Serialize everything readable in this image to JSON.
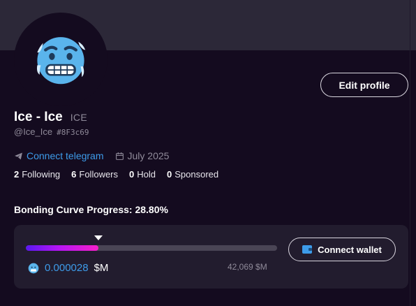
{
  "profile": {
    "name": "Ice - Ice",
    "ticker": "ICE",
    "handle": "@Ice_Ice",
    "hash": "#8F3c69",
    "avatar_icon": "cold-face-emoji",
    "edit_label": "Edit profile",
    "telegram_label": "Connect telegram",
    "date": "July 2025"
  },
  "stats": [
    {
      "count": "2",
      "label": "Following"
    },
    {
      "count": "6",
      "label": "Followers"
    },
    {
      "count": "0",
      "label": "Hold"
    },
    {
      "count": "0",
      "label": "Sponsored"
    }
  ],
  "bonding": {
    "title": "Bonding Curve Progress: 28.80%",
    "progress_percent": 28.8,
    "mcap_value": "0.000028",
    "mcap_unit": "$M",
    "target": "42,069 $M",
    "connect_label": "Connect wallet"
  },
  "colors": {
    "background": "#140b1f",
    "banner": "#2c2838",
    "card": "#221c2e",
    "link": "#3d9be9",
    "muted": "#8f8a99",
    "progress_start": "#5a18f0",
    "progress_end": "#f51fc8"
  },
  "icons": {
    "telegram": "telegram-plane-icon",
    "calendar": "calendar-icon",
    "wallet": "wallet-icon",
    "coin": "token-icon"
  }
}
